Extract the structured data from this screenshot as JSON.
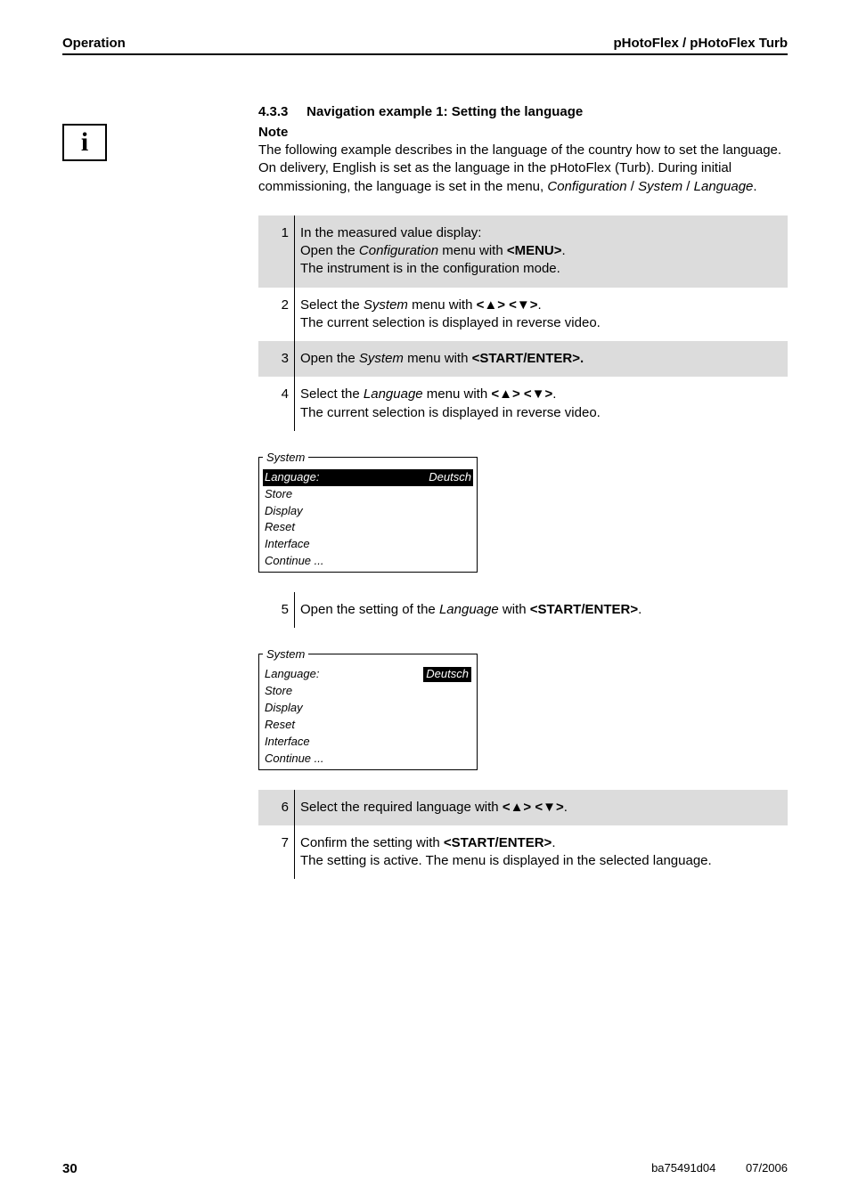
{
  "header": {
    "left": "Operation",
    "right": "pHotoFlex / pHotoFlex Turb"
  },
  "section": {
    "number": "4.3.3",
    "title": "Navigation example 1: Setting the language"
  },
  "note": {
    "heading": "Note",
    "body": "The following example describes in the language of the country how to set the language. On delivery, English is set as the language in the pHotoFlex (Turb). During initial commissioning, the language is set in the menu, ",
    "path1": "Configuration",
    "sep": " / ",
    "path2": "System",
    "path3": "Language",
    "period": "."
  },
  "steps1": [
    {
      "n": "1",
      "line1_pre": "In the measured value display:",
      "line2_pre": "Open the ",
      "line2_ital": "Configuration",
      "line2_mid": " menu with ",
      "line2_key": "<MENU>",
      "line2_post": ".",
      "line3": "The instrument is in the configuration mode."
    },
    {
      "n": "2",
      "line1_pre": "Select the ",
      "line1_ital": "System",
      "line1_mid": " menu with ",
      "line1_key": "<▲> <▼>",
      "line1_post": ".",
      "line2": "The current selection is displayed in reverse video."
    },
    {
      "n": "3",
      "line1_pre": "Open the ",
      "line1_ital": "System",
      "line1_mid": " menu with ",
      "line1_key": "<START/ENTER>.",
      "line1_post": ""
    },
    {
      "n": "4",
      "line1_pre": "Select the ",
      "line1_ital": "Language",
      "line1_mid": " menu with ",
      "line1_key": "<▲> <▼>",
      "line1_post": ".",
      "line2": "The current selection is displayed in reverse video."
    }
  ],
  "menu1": {
    "legend": "System",
    "rows": [
      {
        "label": "Language:",
        "value": "Deutsch",
        "rowHighlighted": true
      },
      {
        "label": "Store"
      },
      {
        "label": "Display"
      },
      {
        "label": "Reset"
      },
      {
        "label": "Interface"
      },
      {
        "label": "Continue ..."
      }
    ]
  },
  "steps2": [
    {
      "n": "5",
      "line1_pre": "Open the setting of the ",
      "line1_ital": "Language ",
      "line1_mid": "with ",
      "line1_key": "<START/ENTER>",
      "line1_post": "."
    }
  ],
  "menu2": {
    "legend": "System",
    "rows": [
      {
        "label": "Language:",
        "value": "Deutsch",
        "valueHighlighted": true
      },
      {
        "label": "Store"
      },
      {
        "label": "Display"
      },
      {
        "label": "Reset"
      },
      {
        "label": "Interface"
      },
      {
        "label": "Continue ..."
      }
    ]
  },
  "steps3": [
    {
      "n": "6",
      "line1_pre": "Select the required language with ",
      "line1_key": "<▲> <▼>",
      "line1_post": "."
    },
    {
      "n": "7",
      "line1_pre": "Confirm the setting with ",
      "line1_key": "<START/ENTER>",
      "line1_post": ".",
      "line2": "The setting is active. The menu is displayed in the selected language."
    }
  ],
  "footer": {
    "page": "30",
    "doc": "ba75491d04",
    "date": "07/2006"
  },
  "info_icon_glyph": "i"
}
